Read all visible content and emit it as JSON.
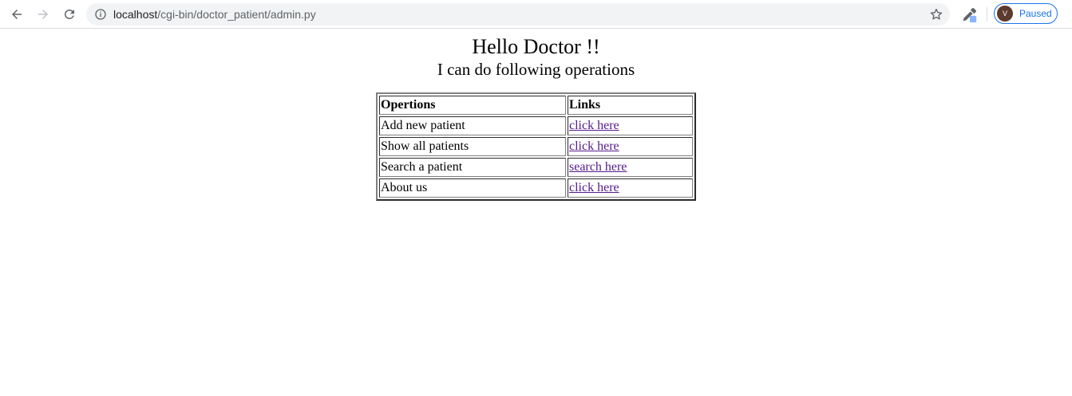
{
  "browser": {
    "url_host": "localhost",
    "url_path": "/cgi-bin/doctor_patient/admin.py",
    "profile_initial": "V",
    "profile_status": "Paused",
    "accent_color": "#1a73e8"
  },
  "page": {
    "title": "Hello Doctor !!",
    "subtitle": "I can do following operations",
    "table": {
      "headers": [
        "Opertions",
        "Links"
      ],
      "rows": [
        {
          "operation": "Add new patient",
          "link": "click here"
        },
        {
          "operation": "Show all patients",
          "link": "click here"
        },
        {
          "operation": "Search a patient",
          "link": "search here"
        },
        {
          "operation": "About us",
          "link": "click here"
        }
      ]
    },
    "link_color": "#551a8b"
  }
}
